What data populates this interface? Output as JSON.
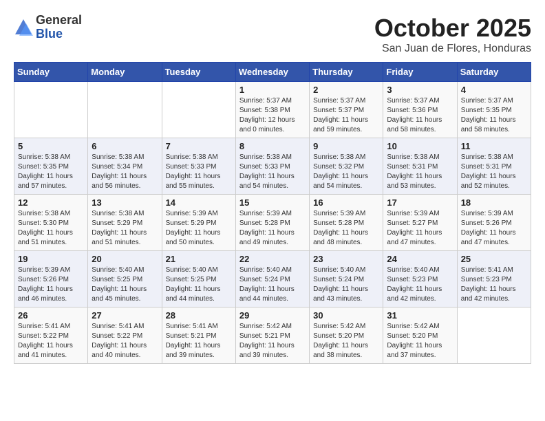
{
  "logo": {
    "general": "General",
    "blue": "Blue"
  },
  "header": {
    "month": "October 2025",
    "location": "San Juan de Flores, Honduras"
  },
  "weekdays": [
    "Sunday",
    "Monday",
    "Tuesday",
    "Wednesday",
    "Thursday",
    "Friday",
    "Saturday"
  ],
  "weeks": [
    [
      {
        "day": "",
        "info": ""
      },
      {
        "day": "",
        "info": ""
      },
      {
        "day": "",
        "info": ""
      },
      {
        "day": "1",
        "info": "Sunrise: 5:37 AM\nSunset: 5:38 PM\nDaylight: 12 hours\nand 0 minutes."
      },
      {
        "day": "2",
        "info": "Sunrise: 5:37 AM\nSunset: 5:37 PM\nDaylight: 11 hours\nand 59 minutes."
      },
      {
        "day": "3",
        "info": "Sunrise: 5:37 AM\nSunset: 5:36 PM\nDaylight: 11 hours\nand 58 minutes."
      },
      {
        "day": "4",
        "info": "Sunrise: 5:37 AM\nSunset: 5:35 PM\nDaylight: 11 hours\nand 58 minutes."
      }
    ],
    [
      {
        "day": "5",
        "info": "Sunrise: 5:38 AM\nSunset: 5:35 PM\nDaylight: 11 hours\nand 57 minutes."
      },
      {
        "day": "6",
        "info": "Sunrise: 5:38 AM\nSunset: 5:34 PM\nDaylight: 11 hours\nand 56 minutes."
      },
      {
        "day": "7",
        "info": "Sunrise: 5:38 AM\nSunset: 5:33 PM\nDaylight: 11 hours\nand 55 minutes."
      },
      {
        "day": "8",
        "info": "Sunrise: 5:38 AM\nSunset: 5:33 PM\nDaylight: 11 hours\nand 54 minutes."
      },
      {
        "day": "9",
        "info": "Sunrise: 5:38 AM\nSunset: 5:32 PM\nDaylight: 11 hours\nand 54 minutes."
      },
      {
        "day": "10",
        "info": "Sunrise: 5:38 AM\nSunset: 5:31 PM\nDaylight: 11 hours\nand 53 minutes."
      },
      {
        "day": "11",
        "info": "Sunrise: 5:38 AM\nSunset: 5:31 PM\nDaylight: 11 hours\nand 52 minutes."
      }
    ],
    [
      {
        "day": "12",
        "info": "Sunrise: 5:38 AM\nSunset: 5:30 PM\nDaylight: 11 hours\nand 51 minutes."
      },
      {
        "day": "13",
        "info": "Sunrise: 5:38 AM\nSunset: 5:29 PM\nDaylight: 11 hours\nand 51 minutes."
      },
      {
        "day": "14",
        "info": "Sunrise: 5:39 AM\nSunset: 5:29 PM\nDaylight: 11 hours\nand 50 minutes."
      },
      {
        "day": "15",
        "info": "Sunrise: 5:39 AM\nSunset: 5:28 PM\nDaylight: 11 hours\nand 49 minutes."
      },
      {
        "day": "16",
        "info": "Sunrise: 5:39 AM\nSunset: 5:28 PM\nDaylight: 11 hours\nand 48 minutes."
      },
      {
        "day": "17",
        "info": "Sunrise: 5:39 AM\nSunset: 5:27 PM\nDaylight: 11 hours\nand 47 minutes."
      },
      {
        "day": "18",
        "info": "Sunrise: 5:39 AM\nSunset: 5:26 PM\nDaylight: 11 hours\nand 47 minutes."
      }
    ],
    [
      {
        "day": "19",
        "info": "Sunrise: 5:39 AM\nSunset: 5:26 PM\nDaylight: 11 hours\nand 46 minutes."
      },
      {
        "day": "20",
        "info": "Sunrise: 5:40 AM\nSunset: 5:25 PM\nDaylight: 11 hours\nand 45 minutes."
      },
      {
        "day": "21",
        "info": "Sunrise: 5:40 AM\nSunset: 5:25 PM\nDaylight: 11 hours\nand 44 minutes."
      },
      {
        "day": "22",
        "info": "Sunrise: 5:40 AM\nSunset: 5:24 PM\nDaylight: 11 hours\nand 44 minutes."
      },
      {
        "day": "23",
        "info": "Sunrise: 5:40 AM\nSunset: 5:24 PM\nDaylight: 11 hours\nand 43 minutes."
      },
      {
        "day": "24",
        "info": "Sunrise: 5:40 AM\nSunset: 5:23 PM\nDaylight: 11 hours\nand 42 minutes."
      },
      {
        "day": "25",
        "info": "Sunrise: 5:41 AM\nSunset: 5:23 PM\nDaylight: 11 hours\nand 42 minutes."
      }
    ],
    [
      {
        "day": "26",
        "info": "Sunrise: 5:41 AM\nSunset: 5:22 PM\nDaylight: 11 hours\nand 41 minutes."
      },
      {
        "day": "27",
        "info": "Sunrise: 5:41 AM\nSunset: 5:22 PM\nDaylight: 11 hours\nand 40 minutes."
      },
      {
        "day": "28",
        "info": "Sunrise: 5:41 AM\nSunset: 5:21 PM\nDaylight: 11 hours\nand 39 minutes."
      },
      {
        "day": "29",
        "info": "Sunrise: 5:42 AM\nSunset: 5:21 PM\nDaylight: 11 hours\nand 39 minutes."
      },
      {
        "day": "30",
        "info": "Sunrise: 5:42 AM\nSunset: 5:20 PM\nDaylight: 11 hours\nand 38 minutes."
      },
      {
        "day": "31",
        "info": "Sunrise: 5:42 AM\nSunset: 5:20 PM\nDaylight: 11 hours\nand 37 minutes."
      },
      {
        "day": "",
        "info": ""
      }
    ]
  ]
}
